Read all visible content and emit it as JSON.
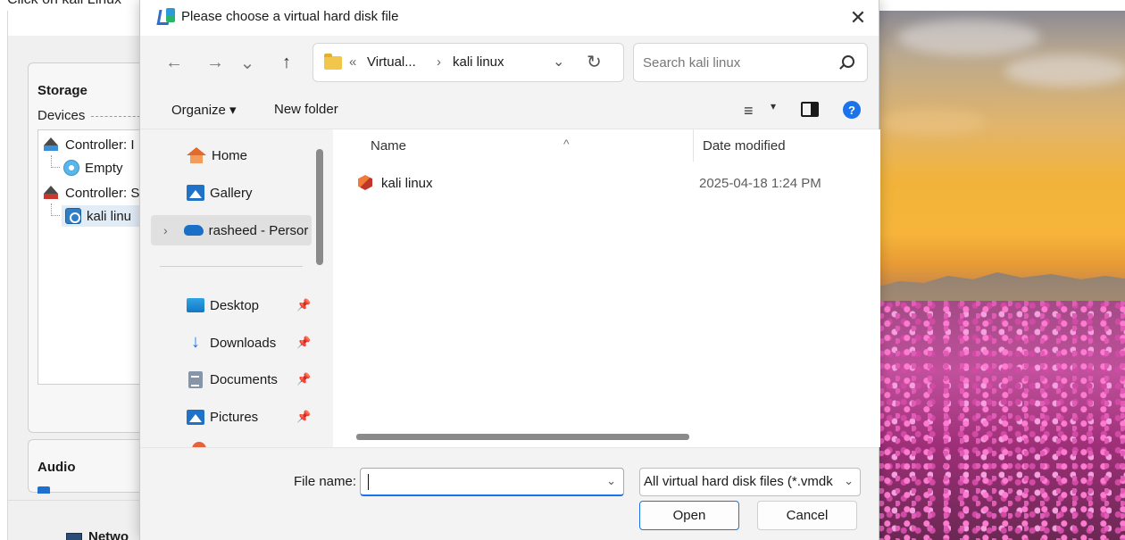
{
  "instruction": "Click on kali Linux",
  "virtualbox": {
    "storage_title": "Storage",
    "devices_label": "Devices",
    "tree": [
      {
        "label": "Controller: I"
      },
      {
        "label": "Empty"
      },
      {
        "label": "Controller: S"
      },
      {
        "label": "kali linu"
      }
    ],
    "audio_title": "Audio",
    "network_label": "Netwo"
  },
  "dialog": {
    "title": "Please choose a virtual hard disk file",
    "close_glyph": "✕",
    "nav": {
      "back": "←",
      "forward": "→",
      "recent": "⌄",
      "up": "↑"
    },
    "address": {
      "overflow": "«",
      "crumbs": [
        "Virtual...",
        "›",
        "kali linux"
      ],
      "dropdown": "⌄",
      "refresh": "↻"
    },
    "search": {
      "placeholder": "Search kali linux"
    },
    "commands": {
      "organize": "Organize ▾",
      "new_folder": "New folder",
      "view_glyph": "≡",
      "view_dropdown": "▾",
      "help": "?"
    },
    "navpane": {
      "items": [
        {
          "label": "Home"
        },
        {
          "label": "Gallery"
        },
        {
          "label": "rasheed - Persor"
        },
        {
          "label": "Desktop"
        },
        {
          "label": "Downloads"
        },
        {
          "label": "Documents"
        },
        {
          "label": "Pictures"
        }
      ],
      "chevron": "›",
      "pin_glyph": "📌"
    },
    "filelist": {
      "columns": [
        "Name",
        "Date modified"
      ],
      "sort_glyph": "^",
      "rows": [
        {
          "name": "kali linux",
          "date": "2025-04-18 1:24 PM"
        }
      ]
    },
    "bottom": {
      "file_name_label": "File name:",
      "file_name_value": "",
      "file_name_dropdown": "⌄",
      "filter": "All virtual hard disk files (*.vmdk",
      "filter_dropdown": "⌄",
      "open": "Open",
      "cancel": "Cancel"
    }
  },
  "colors": {
    "accent": "#1a73e8",
    "dialog_bg": "#f3f3f3"
  }
}
